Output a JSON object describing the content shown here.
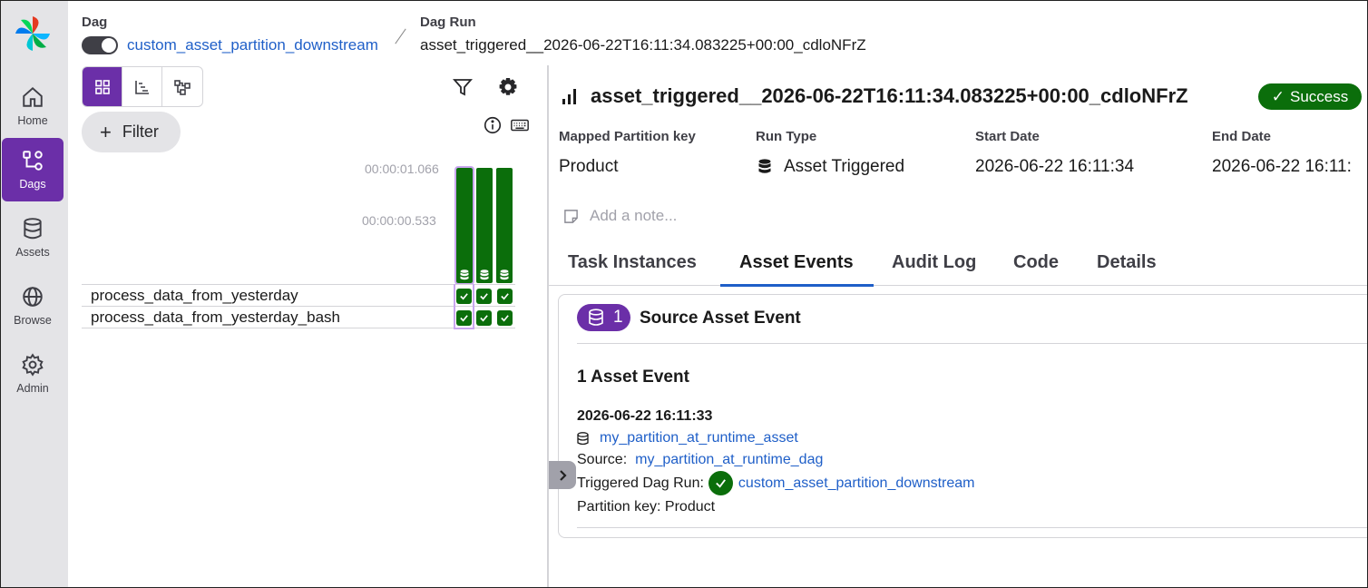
{
  "nav": {
    "items": [
      {
        "label": "Home",
        "icon": "home-icon"
      },
      {
        "label": "Dags",
        "icon": "dags-icon",
        "active": true
      },
      {
        "label": "Assets",
        "icon": "database-icon"
      },
      {
        "label": "Browse",
        "icon": "globe-icon"
      },
      {
        "label": "Admin",
        "icon": "gear-icon"
      }
    ]
  },
  "header": {
    "dag_label": "Dag",
    "dag_name": "custom_asset_partition_downstream",
    "run_label": "Dag Run",
    "run_id": "asset_triggered__2026-06-22T16:11:34.083225+00:00_cdloNFrZ"
  },
  "grid": {
    "view_modes": [
      "grid-view-icon",
      "gantt-view-icon",
      "graph-view-icon"
    ],
    "filter_label": "Filter",
    "durations": [
      "00:00:01.066",
      "00:00:00.533"
    ],
    "tasks": [
      "process_data_from_yesterday",
      "process_data_from_yesterday_bash"
    ],
    "runs": 3,
    "status_color": "#0b6e0b",
    "accent": "#6b2fa8"
  },
  "run": {
    "title": "asset_triggered__2026-06-22T16:11:34.083225+00:00_cdloNFrZ",
    "status": "Success",
    "meta": [
      {
        "label": "Mapped Partition key",
        "value": "Product"
      },
      {
        "label": "Run Type",
        "value": "Asset Triggered"
      },
      {
        "label": "Start Date",
        "value": "2026-06-22 16:11:34"
      },
      {
        "label": "End Date",
        "value": "2026-06-22 16:11:"
      }
    ],
    "note_placeholder": "Add a note...",
    "tabs": [
      "Task Instances",
      "Asset Events",
      "Audit Log",
      "Code",
      "Details"
    ],
    "active_tab": "Asset Events"
  },
  "asset_events": {
    "count": "1",
    "section_title": "Source Asset Event",
    "heading": "1 Asset Event",
    "timestamp": "2026-06-22 16:11:33",
    "asset_name": "my_partition_at_runtime_asset",
    "source_label": "Source:",
    "source_value": "my_partition_at_runtime_dag",
    "triggered_label": "Triggered Dag Run:",
    "triggered_value": "custom_asset_partition_downstream",
    "partition_label": "Partition key: Product"
  }
}
